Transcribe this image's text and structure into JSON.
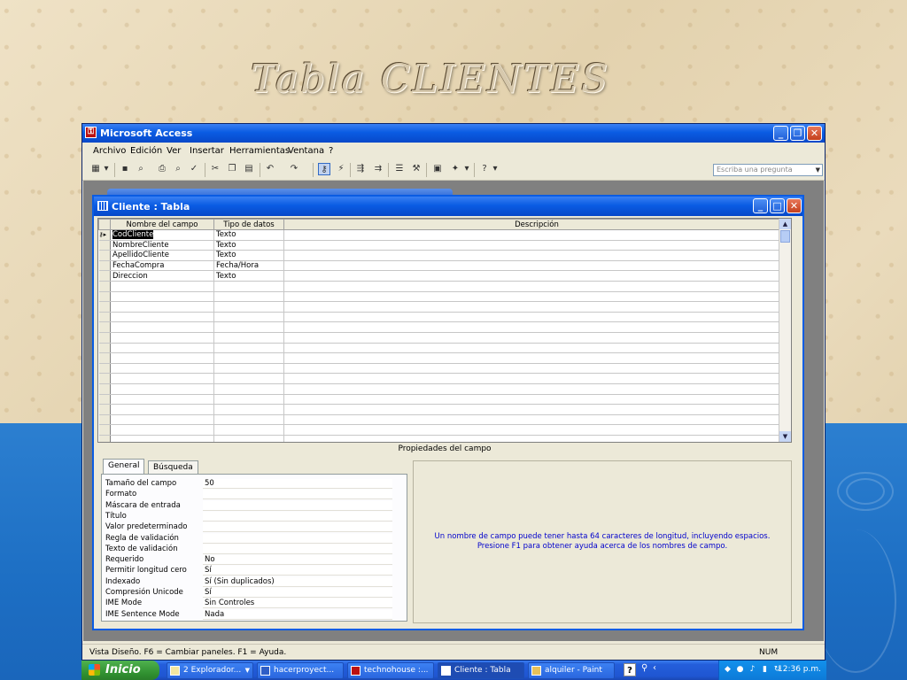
{
  "slide": {
    "title": "Tabla CLIENTES"
  },
  "window": {
    "title": "Microsoft Access",
    "menu": [
      "Archivo",
      "Edición",
      "Ver",
      "Insertar",
      "Herramientas",
      "Ventana",
      "?"
    ],
    "ask_placeholder": "Escriba una pregunta"
  },
  "child": {
    "title": "Cliente : Tabla",
    "columns": {
      "name": "Nombre del campo",
      "type": "Tipo de datos",
      "description": "Descripción"
    },
    "fields": [
      {
        "name": "CodCliente",
        "type": "Texto",
        "description": ""
      },
      {
        "name": "NombreCliente",
        "type": "Texto",
        "description": ""
      },
      {
        "name": "ApellidoCliente",
        "type": "Texto",
        "description": ""
      },
      {
        "name": "FechaCompra",
        "type": "Fecha/Hora",
        "description": ""
      },
      {
        "name": "Direccion",
        "type": "Texto",
        "description": ""
      }
    ],
    "properties_header": "Propiedades del campo",
    "tabs": [
      "General",
      "Búsqueda"
    ],
    "properties": [
      {
        "label": "Tamaño del campo",
        "value": "50"
      },
      {
        "label": "Formato",
        "value": ""
      },
      {
        "label": "Máscara de entrada",
        "value": ""
      },
      {
        "label": "Título",
        "value": ""
      },
      {
        "label": "Valor predeterminado",
        "value": ""
      },
      {
        "label": "Regla de validación",
        "value": ""
      },
      {
        "label": "Texto de validación",
        "value": ""
      },
      {
        "label": "Requerido",
        "value": "No"
      },
      {
        "label": "Permitir longitud cero",
        "value": "Sí"
      },
      {
        "label": "Indexado",
        "value": "Sí (Sin duplicados)"
      },
      {
        "label": "Compresión Unicode",
        "value": "Sí"
      },
      {
        "label": "IME Mode",
        "value": "Sin Controles"
      },
      {
        "label": "IME Sentence Mode",
        "value": "Nada"
      }
    ],
    "help_text": "Un nombre de campo puede tener hasta 64 caracteres de longitud, incluyendo espacios. Presione F1 para obtener ayuda acerca de los nombres de campo."
  },
  "status": {
    "text": "Vista Diseño.  F6 = Cambiar paneles.  F1 = Ayuda.",
    "num": "NUM"
  },
  "taskbar": {
    "start": "Inicio",
    "tasks": [
      "2 Explorador...",
      "hacerproyect...",
      "technohouse :...",
      "Cliente : Tabla",
      "alquiler - Paint"
    ],
    "clock": "12:36 p.m."
  }
}
